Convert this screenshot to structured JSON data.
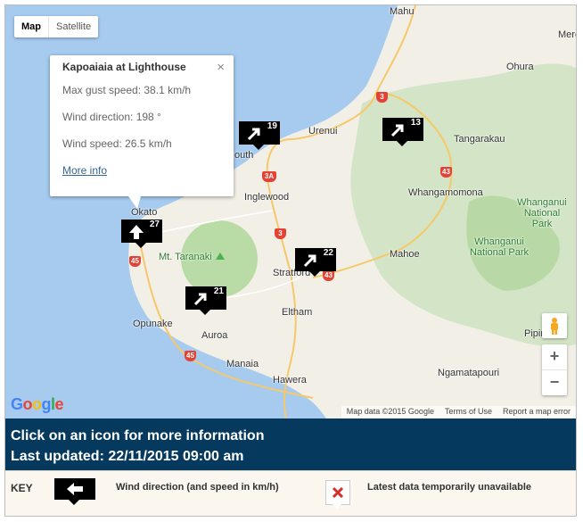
{
  "map": {
    "type_buttons": [
      "Map",
      "Satellite"
    ],
    "places": [
      {
        "label": "Urenui"
      },
      {
        "label": "Ohura"
      },
      {
        "label": "Tangarakau"
      },
      {
        "label": "Whangamomona"
      },
      {
        "label": "Inglewood"
      },
      {
        "label": "Okato"
      },
      {
        "label": "Stratford"
      },
      {
        "label": "Mahoe"
      },
      {
        "label": "Eltham"
      },
      {
        "label": "Opunake"
      },
      {
        "label": "Auroa"
      },
      {
        "label": "Manaia"
      },
      {
        "label": "Hawera"
      },
      {
        "label": "Ngamatapouri"
      },
      {
        "label": "Pipir"
      },
      {
        "label": "Mahu"
      },
      {
        "label": "Mere"
      },
      {
        "label": "outh"
      }
    ],
    "parks": [
      "Mt. Taranaki",
      "Whanganui National Park",
      "Whanganui National Park"
    ],
    "road_shields": [
      "3",
      "3A",
      "3",
      "43",
      "45",
      "45",
      "43"
    ],
    "markers": [
      {
        "speed": "19",
        "direction_deg": 225
      },
      {
        "speed": "13",
        "direction_deg": 225
      },
      {
        "speed": "27",
        "direction_deg": 198
      },
      {
        "speed": "22",
        "direction_deg": 225
      },
      {
        "speed": "21",
        "direction_deg": 225
      }
    ],
    "popup": {
      "title": "Kapoaiaia at Lighthouse",
      "max_gust": "Max gust speed: 38.1 km/h",
      "wind_direction": "Wind direction: 198 °",
      "wind_speed": "Wind speed: 26.5 km/h",
      "more_info": "More info",
      "close": "×"
    },
    "zoom_in": "+",
    "zoom_out": "−",
    "logo": "Google",
    "attribution": [
      "Map data ©2015 Google",
      "Terms of Use",
      "Report a map error"
    ]
  },
  "info": {
    "line1": "Click on an icon for more information",
    "line2": "Last updated: 22/11/2015 09:00 am"
  },
  "key": {
    "label": "KEY",
    "wind_text": "Wind direction (and speed in km/h)",
    "unavailable_text": "Latest data temporarily unavailable"
  },
  "colors": {
    "info_bar": "#06395e",
    "marker": "#000000",
    "unavailable_x": "#d32f2f"
  }
}
